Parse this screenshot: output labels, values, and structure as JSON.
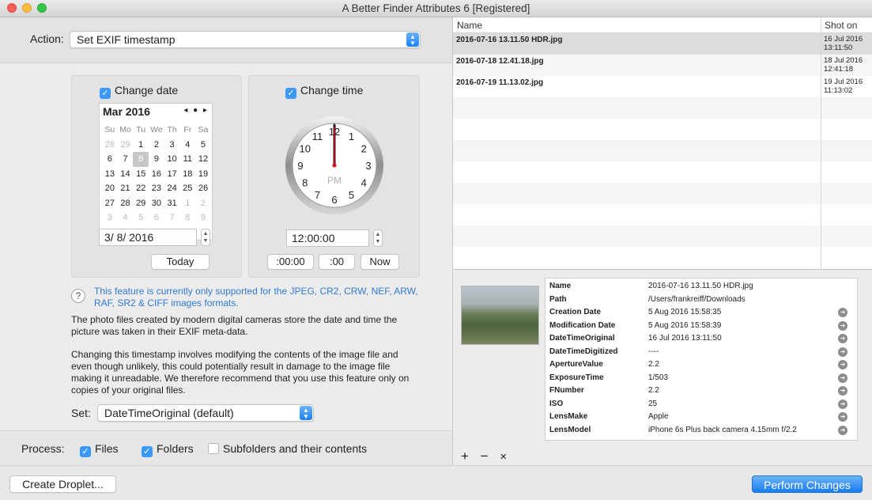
{
  "window": {
    "title": "A Better Finder Attributes 6 [Registered]"
  },
  "action": {
    "label": "Action:",
    "value": "Set EXIF timestamp"
  },
  "date_panel": {
    "checkbox_label": "Change date",
    "month": "Mar 2016",
    "nav": "◂ ● ▸",
    "weekdays": [
      "Su",
      "Mo",
      "Tu",
      "We",
      "Th",
      "Fr",
      "Sa"
    ],
    "weeks": [
      [
        "28",
        "29",
        "1",
        "2",
        "3",
        "4",
        "5"
      ],
      [
        "6",
        "7",
        "8",
        "9",
        "10",
        "11",
        "12"
      ],
      [
        "13",
        "14",
        "15",
        "16",
        "17",
        "18",
        "19"
      ],
      [
        "20",
        "21",
        "22",
        "23",
        "24",
        "25",
        "26"
      ],
      [
        "27",
        "28",
        "29",
        "30",
        "31",
        "1",
        "2"
      ],
      [
        "3",
        "4",
        "5",
        "6",
        "7",
        "8",
        "9"
      ]
    ],
    "date_value": "3/  8/ 2016",
    "today_label": "Today"
  },
  "time_panel": {
    "checkbox_label": "Change time",
    "clock_numbers": [
      "12",
      "1",
      "2",
      "3",
      "4",
      "5",
      "6",
      "7",
      "8",
      "9",
      "10",
      "11"
    ],
    "ampm": "PM",
    "time_value": "12:00:00",
    "btn_00_00": ":00:00",
    "btn_00": ":00",
    "now_label": "Now"
  },
  "notes": {
    "help_icon": "?",
    "support": "This feature is currently only supported for the JPEG, CR2, CRW, NEF, ARW, RAF, SR2 & CIFF images formats.",
    "para1": "The photo files created by modern digital cameras store the date and time the picture was taken in their EXIF meta-data.",
    "para2": "Changing this timestamp involves modifying the contents of the image file and even though unlikely, this could potentially result in damage to the image file making it unreadable. We therefore recommend that you use this feature only on copies of your original files."
  },
  "set": {
    "label": "Set:",
    "value": "DateTimeOriginal (default)"
  },
  "process": {
    "label": "Process:",
    "files": "Files",
    "folders": "Folders",
    "subfolders": "Subfolders and their contents"
  },
  "table": {
    "col_name": "Name",
    "col_shot": "Shot on",
    "rows": [
      {
        "name": "2016-07-16 13.11.50 HDR.jpg",
        "shot_date": "16 Jul 2016",
        "shot_time": "13:11:50"
      },
      {
        "name": "2016-07-18 12.41.18.jpg",
        "shot_date": "18 Jul 2016",
        "shot_time": "12:41:18"
      },
      {
        "name": "2016-07-19 11.13.02.jpg",
        "shot_date": "19 Jul 2016",
        "shot_time": "11:13:02"
      }
    ]
  },
  "info": {
    "rows": [
      {
        "k": "Name",
        "v": "2016-07-16 13.11.50 HDR.jpg"
      },
      {
        "k": "Path",
        "v": "/Users/frankreiff/Downloads"
      },
      {
        "k": "Creation Date",
        "v": "5 Aug 2016 15:58:35"
      },
      {
        "k": "Modification Date",
        "v": "5 Aug 2016 15:58:39"
      },
      {
        "k": "DateTimeOriginal",
        "v": "16 Jul 2016 13:11:50"
      },
      {
        "k": "DateTimeDigitized",
        "v": "----"
      },
      {
        "k": "ApertureValue",
        "v": "2.2"
      },
      {
        "k": "ExposureTime",
        "v": "1/503"
      },
      {
        "k": "FNumber",
        "v": "2.2"
      },
      {
        "k": "ISO",
        "v": "25"
      },
      {
        "k": "LensMake",
        "v": "Apple"
      },
      {
        "k": "LensModel",
        "v": "iPhone 6s Plus back camera 4.15mm f/2.2"
      }
    ],
    "add": "+",
    "remove": "−",
    "clear": "×"
  },
  "buttons": {
    "droplet": "Create Droplet...",
    "perform": "Perform Changes"
  },
  "colors": {
    "accent": "#1a82fb",
    "note_blue": "#2f7ad8"
  }
}
